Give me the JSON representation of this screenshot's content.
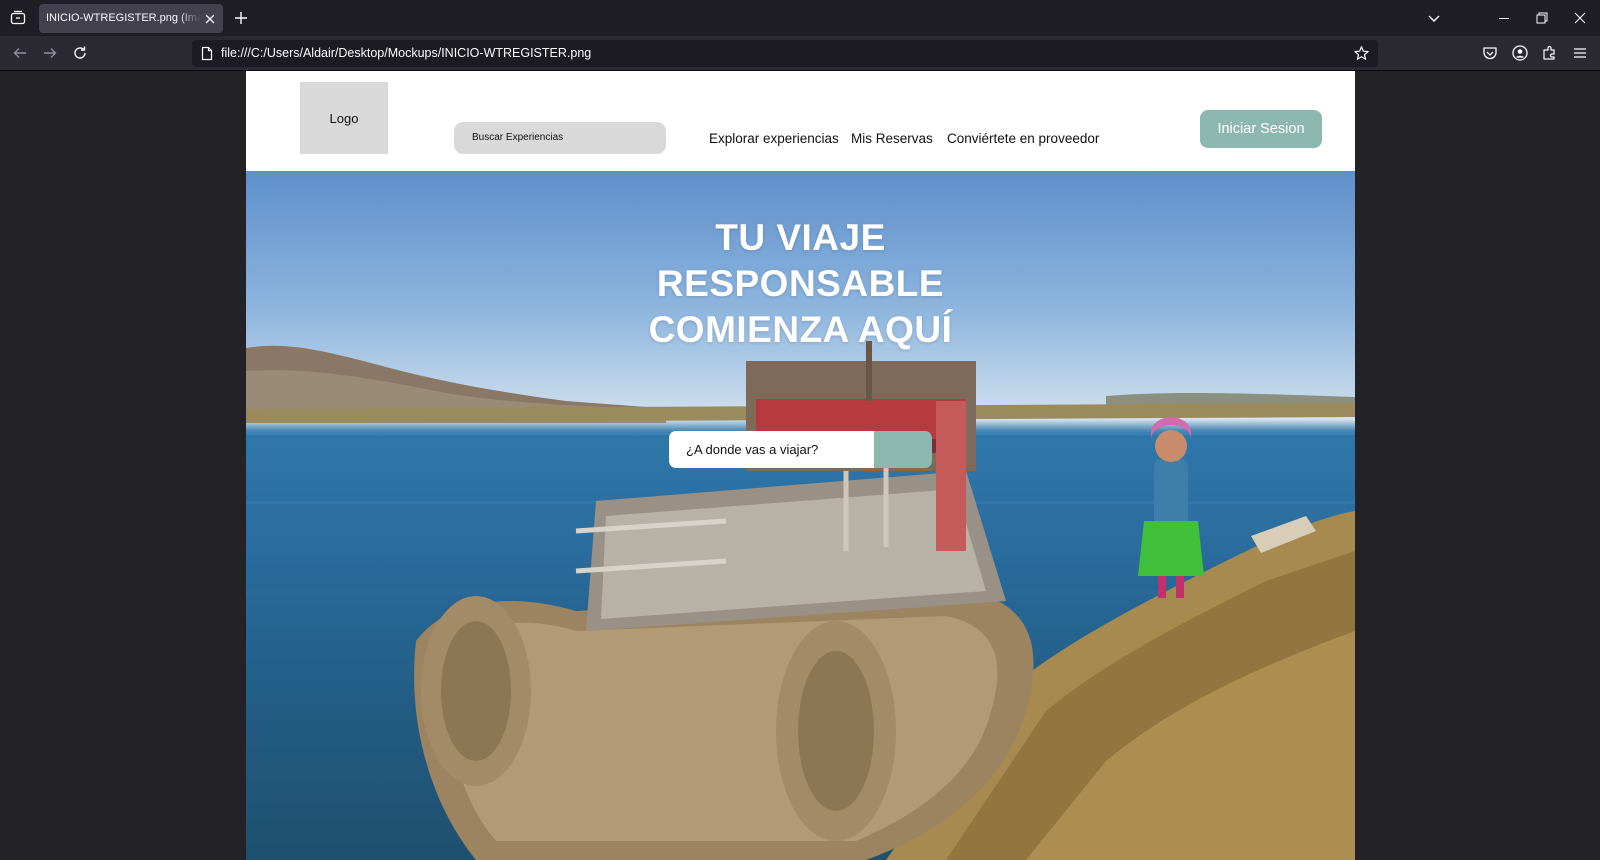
{
  "browser": {
    "tab_title": "INICIO-WTREGISTER.png (Imagen PNG",
    "url": "file:///C:/Users/Aldair/Desktop/Mockups/INICIO-WTREGISTER.png"
  },
  "header": {
    "logo_label": "Logo",
    "search_placeholder": "Buscar Experiencias",
    "nav": [
      {
        "label": "Explorar experiencias"
      },
      {
        "label": "Mis Reservas"
      },
      {
        "label": "Conviértete en proveedor"
      }
    ],
    "login_label": "Iniciar Sesion"
  },
  "hero": {
    "title_lines": [
      "TU VIAJE",
      "RESPONSABLE",
      "COMIENZA AQUÍ"
    ],
    "search_placeholder": "¿A donde vas a viajar?"
  },
  "colors": {
    "accent": "#8db8b0",
    "placeholder_gray": "#d9d9d9",
    "chrome_dark": "#1f1e25",
    "chrome_mid": "#2b2a33"
  },
  "icons": [
    "tab-list-icon",
    "close-icon",
    "plus-icon",
    "chevron-down-icon",
    "minimize-icon",
    "restore-icon",
    "back-arrow-icon",
    "forward-arrow-icon",
    "reload-icon",
    "page-icon",
    "star-icon",
    "pocket-icon",
    "account-icon",
    "extensions-icon",
    "menu-icon"
  ]
}
